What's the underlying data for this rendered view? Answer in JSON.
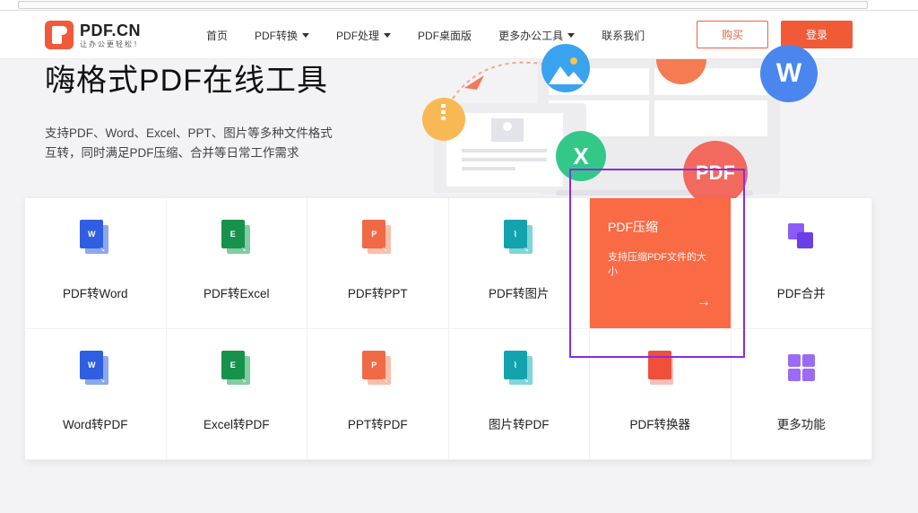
{
  "header": {
    "logo_name": "PDF.CN",
    "logo_slogan": "让办公更轻松！",
    "nav": [
      {
        "label": "首页",
        "dropdown": false
      },
      {
        "label": "PDF转换",
        "dropdown": true
      },
      {
        "label": "PDF处理",
        "dropdown": true
      },
      {
        "label": "PDF桌面版",
        "dropdown": false
      },
      {
        "label": "更多办公工具",
        "dropdown": true
      },
      {
        "label": "联系我们",
        "dropdown": false
      }
    ],
    "buy_label": "购买",
    "login_label": "登录"
  },
  "hero": {
    "title": "嗨格式PDF在线工具",
    "desc_line1": "支持PDF、Word、Excel、PPT、图片等多种文件格式",
    "desc_line2": "互转，同时满足PDF压缩、合并等日常工作需求"
  },
  "illustration": {
    "bubble_w": "W",
    "bubble_x": "X",
    "bubble_pdf": "PDF"
  },
  "tools": [
    {
      "label": "PDF转Word",
      "icon": "word-file-icon",
      "letter": "W",
      "color": "#2f5fe0"
    },
    {
      "label": "PDF转Excel",
      "icon": "excel-file-icon",
      "letter": "E",
      "color": "#1ea055"
    },
    {
      "label": "PDF转PPT",
      "icon": "ppt-file-icon",
      "letter": "P",
      "color": "#f06a45"
    },
    {
      "label": "PDF转图片",
      "icon": "image-file-icon",
      "letter": "",
      "color": "#19b3bb"
    },
    {
      "label": "PDF压缩",
      "icon": "compress-icon",
      "letter": "",
      "color": "#f96a45"
    },
    {
      "label": "PDF合并",
      "icon": "merge-icon",
      "letter": "",
      "color": "#7a4ef0"
    },
    {
      "label": "Word转PDF",
      "icon": "word-file-icon",
      "letter": "W",
      "color": "#2f5fe0"
    },
    {
      "label": "Excel转PDF",
      "icon": "excel-file-icon",
      "letter": "E",
      "color": "#1ea055"
    },
    {
      "label": "PPT转PDF",
      "icon": "ppt-file-icon",
      "letter": "P",
      "color": "#f06a45"
    },
    {
      "label": "图片转PDF",
      "icon": "image-file-icon",
      "letter": "",
      "color": "#19b3bb"
    },
    {
      "label": "PDF转换器",
      "icon": "converter-icon",
      "letter": "",
      "color": "#f0503a"
    },
    {
      "label": "更多功能",
      "icon": "more-apps-icon",
      "letter": "",
      "color": "#9b6cf3"
    }
  ],
  "active_card": {
    "title": "PDF压缩",
    "desc": "支持压缩PDF文件的大小",
    "arrow": "→"
  },
  "colors": {
    "brand": "#f15a36",
    "highlight": "#8a2be2"
  }
}
